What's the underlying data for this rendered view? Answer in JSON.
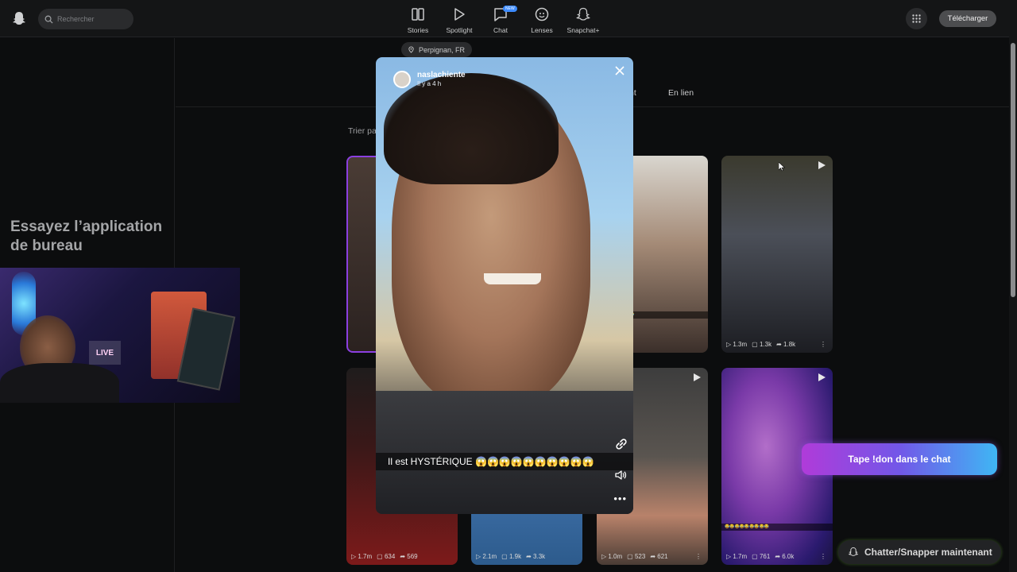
{
  "search": {
    "placeholder": "Rechercher"
  },
  "nav": [
    {
      "label": "Stories",
      "icon": "stories-icon"
    },
    {
      "label": "Spotlight",
      "icon": "spotlight-icon"
    },
    {
      "label": "Chat",
      "icon": "chat-icon",
      "badge": "NEW"
    },
    {
      "label": "Lenses",
      "icon": "lenses-icon"
    },
    {
      "label": "Snapchat+",
      "icon": "snapchat-plus-icon"
    }
  ],
  "header": {
    "download_label": "Télécharger"
  },
  "left": {
    "promo_text": "Essayez l’application de bureau"
  },
  "location": {
    "label": "Perpignan, FR"
  },
  "tabs": {
    "partial": "nt",
    "linked": "En lien"
  },
  "sort": {
    "label": "Trier pa"
  },
  "grid": {
    "cards": [
      {
        "views": "1.3m",
        "comments": "1.3k",
        "shares": "1.8k"
      },
      {
        "views": "1.7m",
        "comments": "634",
        "shares": "569"
      },
      {
        "views": "2.1m",
        "comments": "1.9k",
        "shares": "3.3k"
      },
      {
        "views": "1.0m",
        "comments": "523",
        "shares": "621"
      },
      {
        "views": "1.7m",
        "comments": "761",
        "shares": "6.0k"
      }
    ]
  },
  "modal": {
    "author": "naslachiente",
    "time": "Il y a 4 h",
    "caption": "Il est HYSTÉRIQUE 😱😱😱😱😱😱😱😱😱😱"
  },
  "cta": {
    "label": "Tape !don dans le chat"
  },
  "chat_button": {
    "label": "Chatter/Snapper maintenant"
  },
  "colors": {
    "accent_gradient_start": "#b03bd9",
    "accent_gradient_end": "#3fb6f4",
    "bg": "#0c0d0e"
  }
}
